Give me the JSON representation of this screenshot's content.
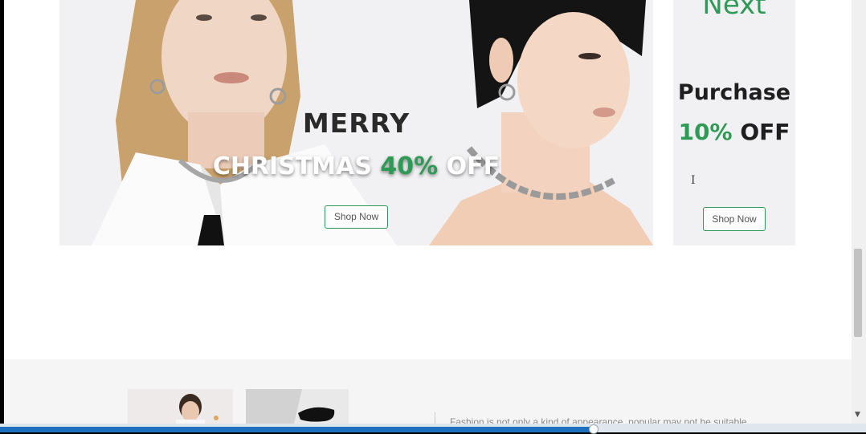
{
  "main_banner": {
    "line1": "MERRY",
    "line2_prefix": "CHRISTMAS",
    "line2_highlight": "40%",
    "line2_suffix": "OFF",
    "button_label": "Shop Now"
  },
  "side_banner": {
    "title": "Next",
    "line1": "Purchase",
    "line2_highlight": "10%",
    "line2_suffix": "OFF",
    "button_label": "Shop Now"
  },
  "lower_section": {
    "description": "Fashion is not only a kind of appearance, popular may not be suitable"
  },
  "progress": {
    "value": 0.685
  },
  "colors": {
    "accent": "#2f9a55",
    "progress": "#1f6fbf"
  }
}
